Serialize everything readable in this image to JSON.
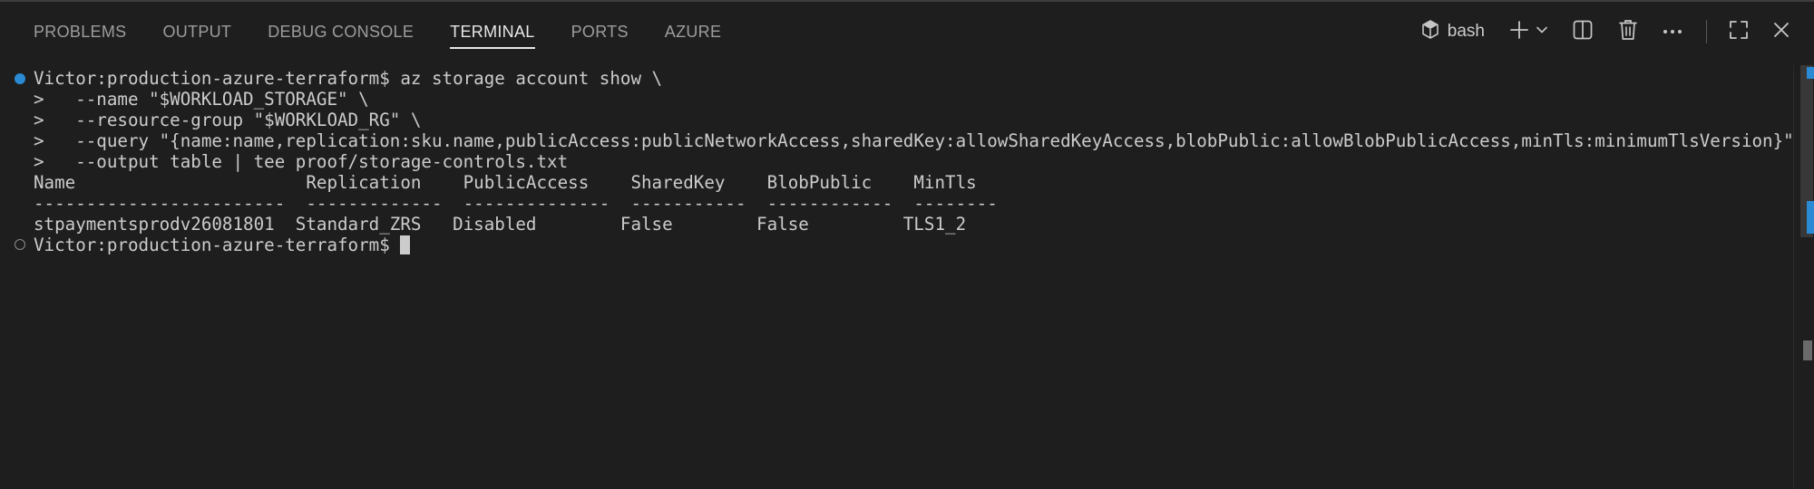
{
  "tabs": [
    {
      "label": "PROBLEMS",
      "active": false
    },
    {
      "label": "OUTPUT",
      "active": false
    },
    {
      "label": "DEBUG CONSOLE",
      "active": false
    },
    {
      "label": "TERMINAL",
      "active": true
    },
    {
      "label": "PORTS",
      "active": false
    },
    {
      "label": "AZURE",
      "active": false
    }
  ],
  "toolbar": {
    "profile_icon": "terminal-shell-icon",
    "profile_label": "bash",
    "new_terminal_icon": "plus-icon",
    "dropdown_icon": "chevron-down-icon",
    "split_icon": "split-terminal-icon",
    "kill_icon": "trash-icon",
    "more_icon": "ellipsis-icon",
    "maximize_icon": "maximize-panel-icon",
    "close_icon": "close-icon"
  },
  "terminal": {
    "lines": [
      "Victor:production-azure-terraform$ az storage account show \\",
      ">   --name \"$WORKLOAD_STORAGE\" \\",
      ">   --resource-group \"$WORKLOAD_RG\" \\",
      ">   --query \"{name:name,replication:sku.name,publicAccess:publicNetworkAccess,sharedKey:allowSharedKeyAccess,blobPublic:allowBlobPublicAccess,minTls:minimumTlsVersion}\" \\",
      ">   --output table | tee proof/storage-controls.txt",
      "Name                      Replication    PublicAccess    SharedKey    BlobPublic    MinTls",
      "------------------------  -------------  --------------  -----------  ------------  --------",
      "stpaymentsprodv26081801  Standard_ZRS   Disabled        False        False         TLS1_2",
      "Victor:production-azure-terraform$ "
    ],
    "decorations": [
      {
        "line": 0,
        "status": "success"
      },
      {
        "line": 8,
        "status": "pending"
      }
    ]
  },
  "colors": {
    "background": "#1e1e1e",
    "text": "#cccccc",
    "tab_inactive": "#9d9d9d",
    "tab_active": "#e7e7e7",
    "accent": "#2a8ad4"
  }
}
